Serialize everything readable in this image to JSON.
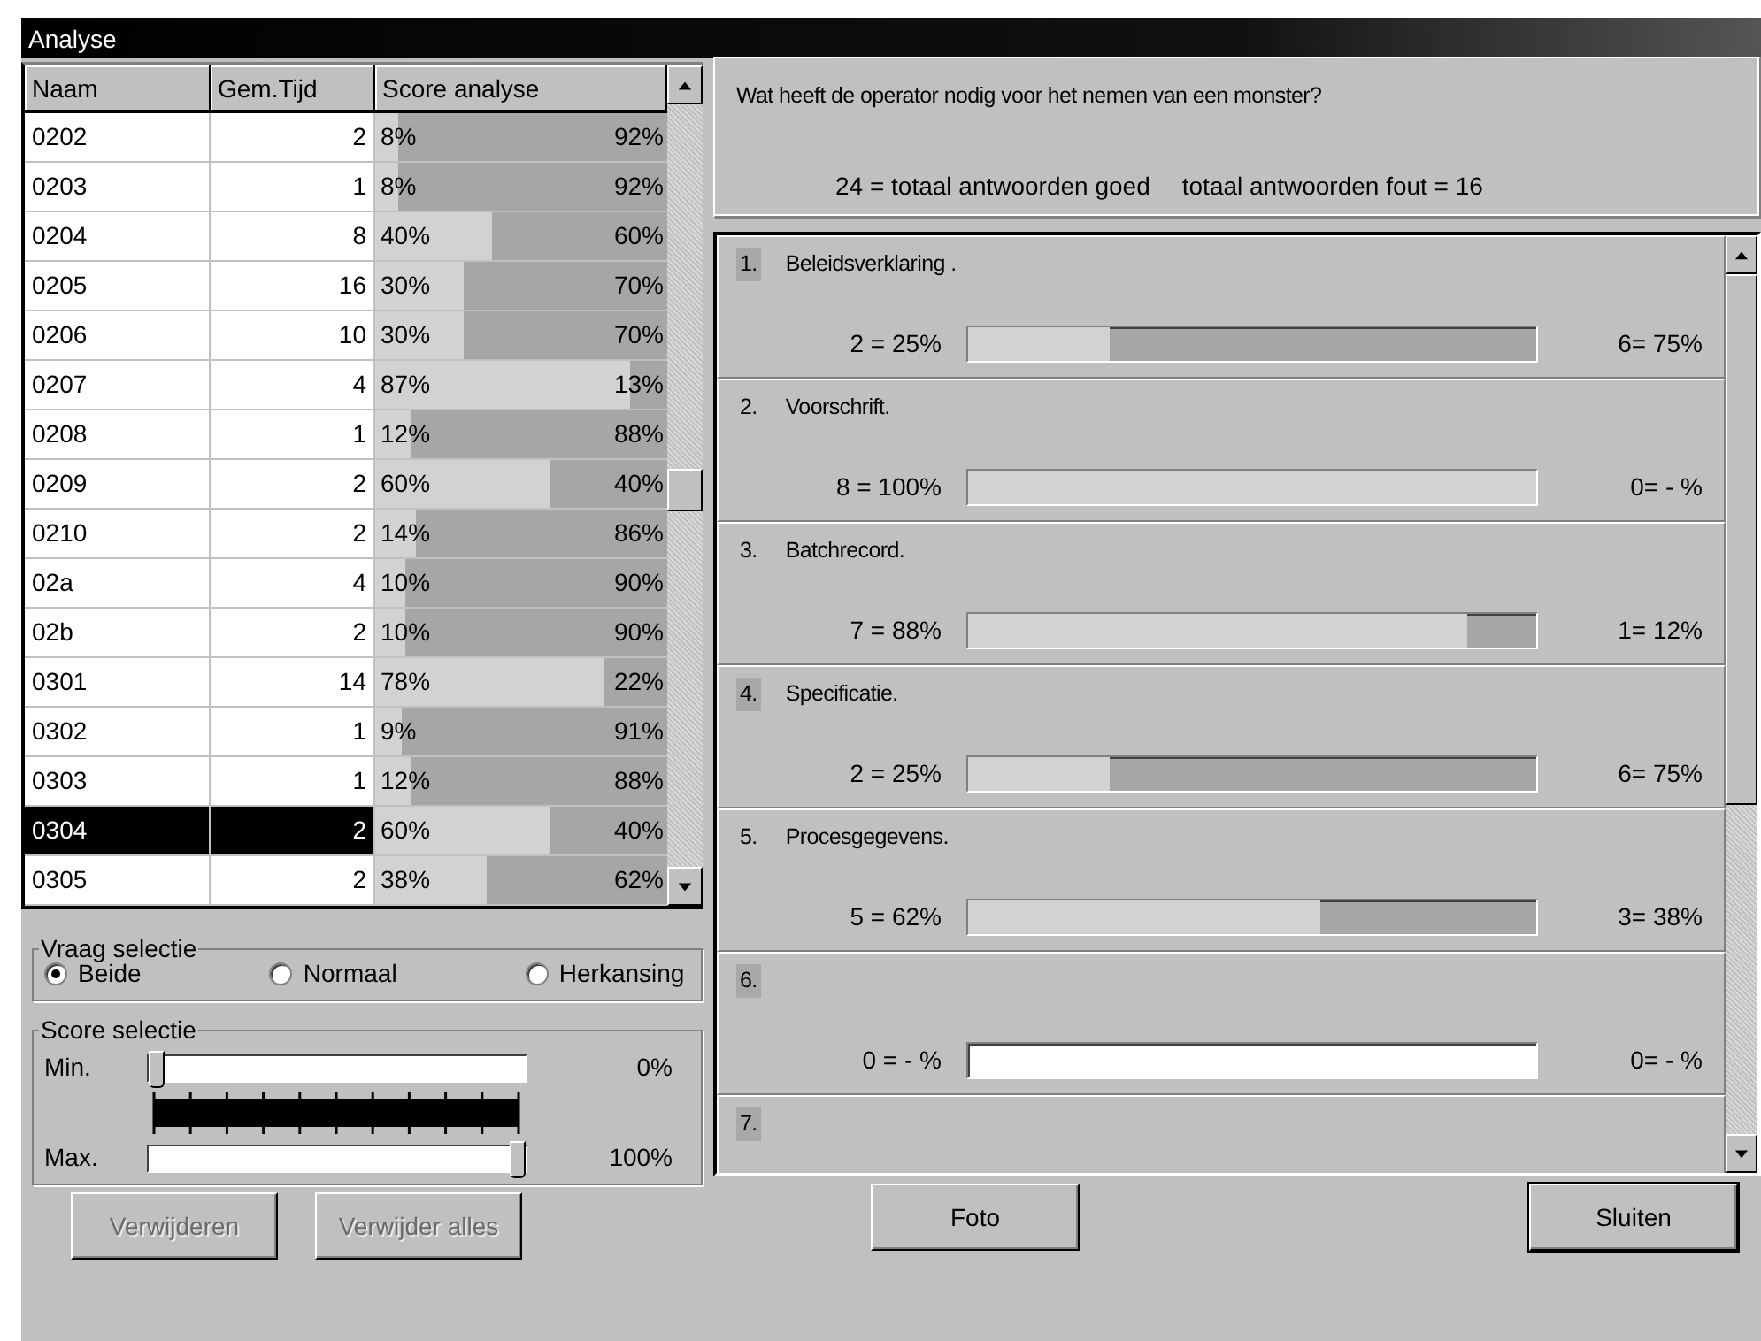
{
  "window": {
    "title": "Analyse"
  },
  "table": {
    "columns": [
      "Naam",
      "Gem.Tijd",
      "Score analyse"
    ],
    "rows": [
      {
        "naam": "0202",
        "tijd": "2",
        "good": "8%",
        "bad": "92%",
        "level": 0.08,
        "selected": false
      },
      {
        "naam": "0203",
        "tijd": "1",
        "good": "8%",
        "bad": "92%",
        "level": 0.08,
        "selected": false
      },
      {
        "naam": "0204",
        "tijd": "8",
        "good": "40%",
        "bad": "60%",
        "level": 0.4,
        "selected": false
      },
      {
        "naam": "0205",
        "tijd": "16",
        "good": "30%",
        "bad": "70%",
        "level": 0.3,
        "selected": false
      },
      {
        "naam": "0206",
        "tijd": "10",
        "good": "30%",
        "bad": "70%",
        "level": 0.3,
        "selected": false
      },
      {
        "naam": "0207",
        "tijd": "4",
        "good": "87%",
        "bad": "13%",
        "level": 0.87,
        "selected": false
      },
      {
        "naam": "0208",
        "tijd": "1",
        "good": "12%",
        "bad": "88%",
        "level": 0.12,
        "selected": false
      },
      {
        "naam": "0209",
        "tijd": "2",
        "good": "60%",
        "bad": "40%",
        "level": 0.6,
        "selected": false
      },
      {
        "naam": "0210",
        "tijd": "2",
        "good": "14%",
        "bad": "86%",
        "level": 0.14,
        "selected": false
      },
      {
        "naam": "02a",
        "tijd": "4",
        "good": "10%",
        "bad": "90%",
        "level": 0.1,
        "selected": false
      },
      {
        "naam": "02b",
        "tijd": "2",
        "good": "10%",
        "bad": "90%",
        "level": 0.1,
        "selected": false
      },
      {
        "naam": "0301",
        "tijd": "14",
        "good": "78%",
        "bad": "22%",
        "level": 0.78,
        "selected": false
      },
      {
        "naam": "0302",
        "tijd": "1",
        "good": "9%",
        "bad": "91%",
        "level": 0.09,
        "selected": false
      },
      {
        "naam": "0303",
        "tijd": "1",
        "good": "12%",
        "bad": "88%",
        "level": 0.12,
        "selected": false
      },
      {
        "naam": "0304",
        "tijd": "2",
        "good": "60%",
        "bad": "40%",
        "level": 0.6,
        "selected": true
      },
      {
        "naam": "0305",
        "tijd": "2",
        "good": "38%",
        "bad": "62%",
        "level": 0.38,
        "selected": false
      }
    ]
  },
  "vraag_selectie": {
    "title": "Vraag selectie",
    "options": [
      {
        "label": "Beide",
        "selected": true
      },
      {
        "label": "Normaal",
        "selected": false
      },
      {
        "label": "Herkansing",
        "selected": false
      }
    ]
  },
  "score_selectie": {
    "title": "Score selectie",
    "sliders": [
      {
        "label": "Min.",
        "level": 0,
        "reading": "0%"
      },
      {
        "label": "Max.",
        "level": 1,
        "reading": "100%"
      }
    ]
  },
  "question": {
    "text": "Wat heeft de operator nodig voor het nemen van een monster?",
    "goed": "24 = totaal antwoorden goed",
    "fout": "totaal antwoorden fout = 16"
  },
  "answers": [
    {
      "number": "1.",
      "text": "Beleidsverklaring .",
      "highlighted": true,
      "kind": "scored",
      "left": "2 = 25%",
      "right": "6= 75%",
      "level": 0.25
    },
    {
      "number": "2.",
      "text": "Voorschrift.",
      "highlighted": false,
      "kind": "scored",
      "left": "8 = 100%",
      "right": "0= - %",
      "level": 1
    },
    {
      "number": "3.",
      "text": "Batchrecord.",
      "highlighted": false,
      "kind": "scored",
      "left": "7 = 88%",
      "right": "1= 12%",
      "level": 0.88
    },
    {
      "number": "4.",
      "text": "Specificatie.",
      "highlighted": true,
      "kind": "scored",
      "left": "2 = 25%",
      "right": "6= 75%",
      "level": 0.25
    },
    {
      "number": "5.",
      "text": "Procesgegevens.",
      "highlighted": false,
      "kind": "scored",
      "left": "5 = 62%",
      "right": "3= 38%",
      "level": 0.62
    },
    {
      "number": "6.",
      "highlighted": true,
      "kind": "unscored",
      "left": "0 = - %",
      "right": "0= - %"
    },
    {
      "number": "7.",
      "highlighted": true,
      "kind": "cut"
    }
  ],
  "buttons": [
    {
      "label": "Verwijderen",
      "disabled": true,
      "default": false
    },
    {
      "label": "Verwijder alles",
      "disabled": true,
      "default": false
    },
    {
      "label": "Foto",
      "disabled": false,
      "default": false
    },
    {
      "label": "Sluiten",
      "disabled": false,
      "default": true
    }
  ]
}
